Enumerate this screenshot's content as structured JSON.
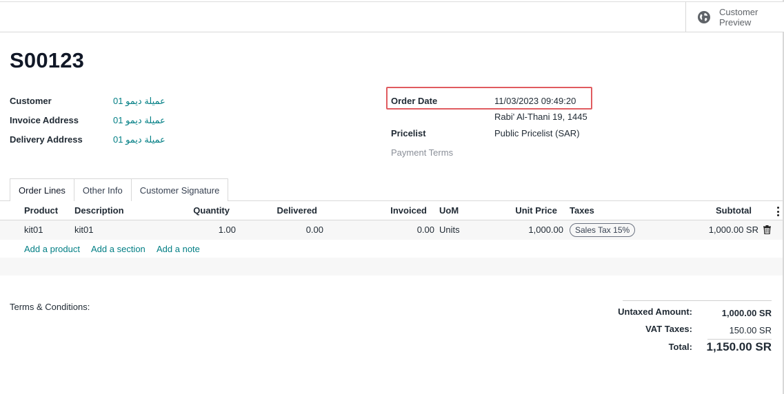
{
  "header": {
    "preview_label": "Customer Preview",
    "preview_icon": "globe-icon"
  },
  "order": {
    "name": "S00123"
  },
  "fields": {
    "customer_label": "Customer",
    "customer_value": "عميلة ديمو 01",
    "invoice_address_label": "Invoice Address",
    "invoice_address_value": "عميلة ديمو 01",
    "delivery_address_label": "Delivery Address",
    "delivery_address_value": "عميلة ديمو 01",
    "order_date_label": "Order Date",
    "order_date_value": "11/03/2023 09:49:20",
    "order_date_hijri": "Rabi' Al-Thani 19, 1445",
    "pricelist_label": "Pricelist",
    "pricelist_value": "Public Pricelist (SAR)",
    "payment_terms_label": "Payment Terms"
  },
  "tabs": [
    {
      "label": "Order Lines",
      "active": true
    },
    {
      "label": "Other Info",
      "active": false
    },
    {
      "label": "Customer Signature",
      "active": false
    }
  ],
  "table": {
    "columns": {
      "product": "Product",
      "description": "Description",
      "quantity": "Quantity",
      "delivered": "Delivered",
      "invoiced": "Invoiced",
      "uom": "UoM",
      "unit_price": "Unit Price",
      "taxes": "Taxes",
      "subtotal": "Subtotal"
    },
    "rows": [
      {
        "product": "kit01",
        "description": "kit01",
        "quantity": "1.00",
        "delivered": "0.00",
        "invoiced": "0.00",
        "uom": "Units",
        "unit_price": "1,000.00",
        "taxes": "Sales Tax 15%",
        "subtotal": "1,000.00 SR"
      }
    ],
    "add_product": "Add a product",
    "add_section": "Add a section",
    "add_note": "Add a note"
  },
  "terms_label": "Terms & Conditions:",
  "totals": {
    "untaxed_label": "Untaxed Amount:",
    "untaxed_value": "1,000.00 SR",
    "vat_label": "VAT Taxes:",
    "vat_value": "150.00 SR",
    "total_label": "Total:",
    "total_value": "1,150.00 SR"
  },
  "colors": {
    "link": "#017e84",
    "highlight": "#e05b5f"
  }
}
